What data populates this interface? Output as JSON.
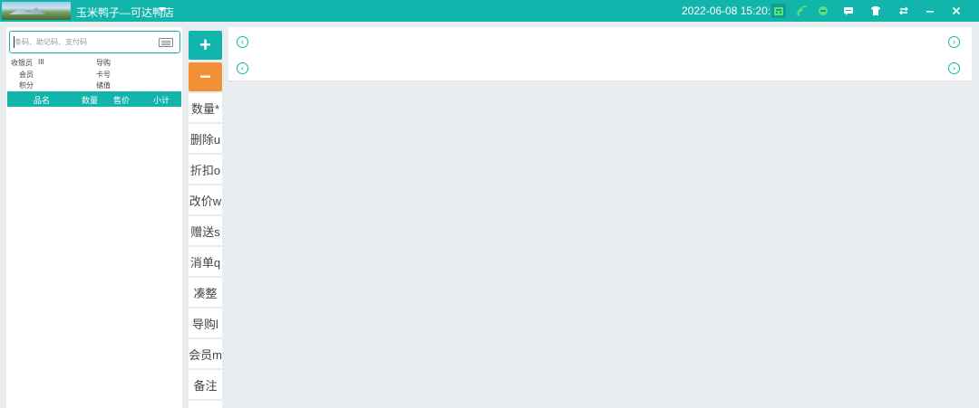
{
  "titlebar": {
    "store_name": "玉米鸭子—可达鸭店",
    "datetime": "2022-06-08 15:20:16",
    "icons": [
      "logo-landscape",
      "chevron-down-icon",
      "cash-register-icon",
      "wifi-icon",
      "online-status-icon",
      "message-icon",
      "shirt-skin-icon",
      "switch-arrows-icon",
      "minimize-icon",
      "close-icon"
    ]
  },
  "search": {
    "placeholder": "条码、助记码、支付码"
  },
  "info": {
    "cashier_label": "收银员",
    "cashier_value": "III",
    "guide_label": "导购",
    "member_label": "会员",
    "card_label": "卡号",
    "points_label": "积分",
    "stored_label": "储值"
  },
  "table": {
    "headers": [
      "品名",
      "数量",
      "售价",
      "小计"
    ]
  },
  "actions": {
    "plus": "+",
    "minus": "−",
    "buttons": [
      "数量*",
      "删除u",
      "折扣o",
      "改价w",
      "赠送s",
      "消单q",
      "凑整",
      "导购l",
      "会员m",
      "备注"
    ]
  },
  "colors": {
    "accent": "#12b5ab",
    "minus": "#f39035",
    "background": "#eaedf0"
  }
}
